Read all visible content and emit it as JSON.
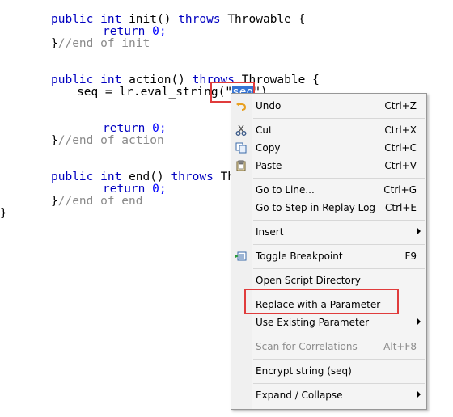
{
  "code": {
    "init_sig": {
      "kw1": "public",
      "kw2": "int",
      "name": "init()",
      "kw3": "throws",
      "exc": "Throwable {"
    },
    "init_return_kw": "return",
    "init_return_val": "0;",
    "init_end_brace": "}",
    "init_end_comment": "//end of init",
    "action_sig": {
      "kw1": "public",
      "kw2": "int",
      "name": "action()",
      "kw3": "throws",
      "exc": "Throwable {"
    },
    "action_stmt_prefix": "seq = lr.eval_string(\"",
    "action_stmt_selected": "seq",
    "action_stmt_suffix": "\")",
    "action_return_kw": "return",
    "action_return_val": "0;",
    "action_end_brace": "}",
    "action_end_comment": "//end of action",
    "end_sig": {
      "kw1": "public",
      "kw2": "int",
      "name": "end()",
      "kw3": "throws",
      "exc": "Thro"
    },
    "end_return_kw": "return",
    "end_return_val": "0;",
    "end_end_brace": "}",
    "end_end_comment": "//end of end",
    "class_end_brace": "}"
  },
  "context_menu": {
    "items": [
      {
        "label": "Undo",
        "shortcut": "Ctrl+Z",
        "icon": "undo-icon"
      },
      {
        "label": "Cut",
        "shortcut": "Ctrl+X",
        "icon": "scissors-icon"
      },
      {
        "label": "Copy",
        "shortcut": "Ctrl+C",
        "icon": "copy-icon"
      },
      {
        "label": "Paste",
        "shortcut": "Ctrl+V",
        "icon": "clipboard-icon"
      },
      {
        "label": "Go to Line...",
        "shortcut": "Ctrl+G"
      },
      {
        "label": "Go to Step in Replay Log",
        "shortcut": "Ctrl+E"
      },
      {
        "label": "Insert",
        "submenu": true
      },
      {
        "label": "Toggle Breakpoint",
        "shortcut": "F9",
        "icon": "breakpoint-icon"
      },
      {
        "label": "Open Script Directory"
      },
      {
        "label": "Replace with a Parameter",
        "highlighted_box": true
      },
      {
        "label": "Use Existing Parameter",
        "submenu": true
      },
      {
        "label": "Scan for Correlations",
        "shortcut": "Alt+F8",
        "disabled": true
      },
      {
        "label": "Encrypt string (seq)"
      },
      {
        "label": "Expand / Collapse",
        "submenu": true
      }
    ]
  },
  "colors": {
    "keyword": "#0000c0",
    "comment": "#8a8a8a",
    "selection": "#3574d4",
    "annotation_box": "#e03c3c"
  }
}
